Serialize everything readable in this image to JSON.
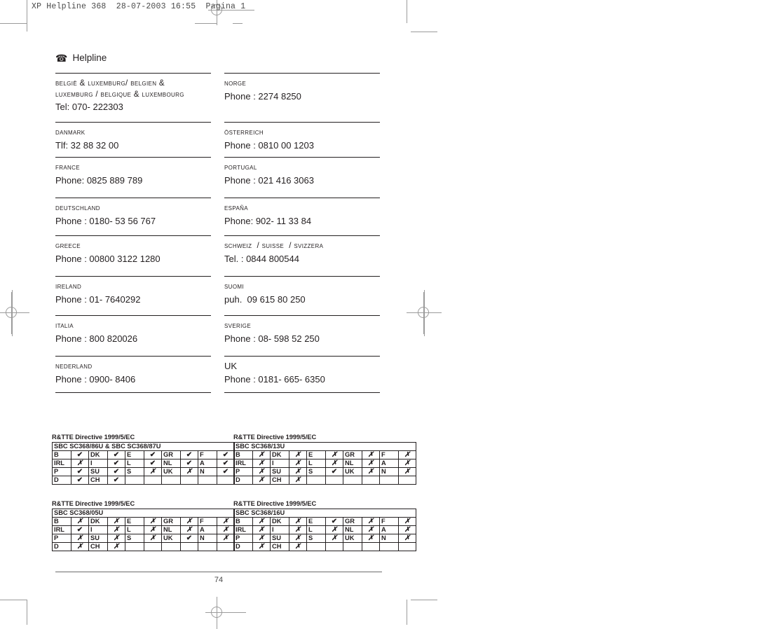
{
  "document": {
    "header_line": "XP Helpline 368  28-07-2003 16:55  Pagina 1",
    "title": "Helpline",
    "phone_icon": "☎",
    "page_number": "74"
  },
  "contacts": {
    "left_column": [
      {
        "country": "België & Luxemburg/ Belgien &\nLuxemburg / Belgique & Luxembourg",
        "phone": "Tel: 070- 222303"
      },
      {
        "country": "Danmark",
        "phone": "Tlf: 32 88 32 00"
      },
      {
        "country": "France",
        "phone": "Phone: 0825 889 789"
      },
      {
        "country": "Deutschland",
        "phone": "Phone : 0180- 53 56 767"
      },
      {
        "country": "Greece",
        "phone": "Phone : 00800 3122 1280"
      },
      {
        "country": "Ireland",
        "phone": "Phone : 01- 7640292"
      },
      {
        "country": "Italia",
        "phone": "Phone : 800 820026"
      },
      {
        "country": "Nederland",
        "phone": "Phone : 0900- 8406"
      }
    ],
    "right_column": [
      {
        "country": "Norge",
        "phone": "Phone : 2274 8250"
      },
      {
        "country": "Österreich",
        "phone": "Phone : 0810 00 1203"
      },
      {
        "country": "Portugal",
        "phone": "Phone : 021 416 3063"
      },
      {
        "country": "España",
        "phone": "Phone: 902- 11 33 84"
      },
      {
        "country": "Schweiz  / Suisse  / Svizzera",
        "phone": "Tel. : 0844 800544"
      },
      {
        "country": "Suomi",
        "phone": "puh.  09 615 80 250"
      },
      {
        "country": "Sverige",
        "phone": "Phone : 08- 598 52 250"
      },
      {
        "country": "UK",
        "phone": "Phone : 0181- 665- 6350"
      }
    ]
  },
  "rtte_tables": [
    {
      "directive": "R&TTE Directive 1999/5/EC",
      "model": "SBC SC368/86U & SBC SC368/87U",
      "rows": [
        [
          {
            "label": "B",
            "mark": "✔"
          },
          {
            "label": "DK",
            "mark": "✔"
          },
          {
            "label": "E",
            "mark": "✔"
          },
          {
            "label": "GR",
            "mark": "✔"
          },
          {
            "label": "F",
            "mark": "✔"
          }
        ],
        [
          {
            "label": "IRL",
            "mark": "✗"
          },
          {
            "label": "I",
            "mark": "✔"
          },
          {
            "label": "L",
            "mark": "✔"
          },
          {
            "label": "NL",
            "mark": "✔"
          },
          {
            "label": "A",
            "mark": "✔"
          }
        ],
        [
          {
            "label": "P",
            "mark": "✔"
          },
          {
            "label": "SU",
            "mark": "✔"
          },
          {
            "label": "S",
            "mark": "✗"
          },
          {
            "label": "UK",
            "mark": "✗"
          },
          {
            "label": "N",
            "mark": "✔"
          }
        ],
        [
          {
            "label": "D",
            "mark": "✔"
          },
          {
            "label": "CH",
            "mark": "✔"
          },
          {
            "label": "",
            "mark": ""
          },
          {
            "label": "",
            "mark": ""
          },
          {
            "label": "",
            "mark": ""
          }
        ]
      ]
    },
    {
      "directive": "R&TTE Directive 1999/5/EC",
      "model": "SBC SC368/13U",
      "rows": [
        [
          {
            "label": "B",
            "mark": "✗"
          },
          {
            "label": "DK",
            "mark": "✗"
          },
          {
            "label": "E",
            "mark": "✗"
          },
          {
            "label": "GR",
            "mark": "✗"
          },
          {
            "label": "F",
            "mark": "✗"
          }
        ],
        [
          {
            "label": "IRL",
            "mark": "✗"
          },
          {
            "label": "I",
            "mark": "✗"
          },
          {
            "label": "L",
            "mark": "✗"
          },
          {
            "label": "NL",
            "mark": "✗"
          },
          {
            "label": "A",
            "mark": "✗"
          }
        ],
        [
          {
            "label": "P",
            "mark": "✗"
          },
          {
            "label": "SU",
            "mark": "✗"
          },
          {
            "label": "S",
            "mark": "✔"
          },
          {
            "label": "UK",
            "mark": "✗"
          },
          {
            "label": "N",
            "mark": "✗"
          }
        ],
        [
          {
            "label": "D",
            "mark": "✗"
          },
          {
            "label": "CH",
            "mark": "✗"
          },
          {
            "label": "",
            "mark": ""
          },
          {
            "label": "",
            "mark": ""
          },
          {
            "label": "",
            "mark": ""
          }
        ]
      ]
    },
    {
      "directive": "R&TTE Directive 1999/5/EC",
      "model": "SBC SC368/05U",
      "rows": [
        [
          {
            "label": "B",
            "mark": "✗"
          },
          {
            "label": "DK",
            "mark": "✗"
          },
          {
            "label": "E",
            "mark": "✗"
          },
          {
            "label": "GR",
            "mark": "✗"
          },
          {
            "label": "F",
            "mark": "✗"
          }
        ],
        [
          {
            "label": "IRL",
            "mark": "✔"
          },
          {
            "label": "I",
            "mark": "✗"
          },
          {
            "label": "L",
            "mark": "✗"
          },
          {
            "label": "NL",
            "mark": "✗"
          },
          {
            "label": "A",
            "mark": "✗"
          }
        ],
        [
          {
            "label": "P",
            "mark": "✗"
          },
          {
            "label": "SU",
            "mark": "✗"
          },
          {
            "label": "S",
            "mark": "✗"
          },
          {
            "label": "UK",
            "mark": "✔"
          },
          {
            "label": "N",
            "mark": "✗"
          }
        ],
        [
          {
            "label": "D",
            "mark": "✗"
          },
          {
            "label": "CH",
            "mark": "✗"
          },
          {
            "label": "",
            "mark": ""
          },
          {
            "label": "",
            "mark": ""
          },
          {
            "label": "",
            "mark": ""
          }
        ]
      ]
    },
    {
      "directive": "R&TTE Directive 1999/5/EC",
      "model": "SBC SC368/16U",
      "rows": [
        [
          {
            "label": "B",
            "mark": "✗"
          },
          {
            "label": "DK",
            "mark": "✗"
          },
          {
            "label": "E",
            "mark": "✔"
          },
          {
            "label": "GR",
            "mark": "✗"
          },
          {
            "label": "F",
            "mark": "✗"
          }
        ],
        [
          {
            "label": "IRL",
            "mark": "✗"
          },
          {
            "label": "I",
            "mark": "✗"
          },
          {
            "label": "L",
            "mark": "✗"
          },
          {
            "label": "NL",
            "mark": "✗"
          },
          {
            "label": "A",
            "mark": "✗"
          }
        ],
        [
          {
            "label": "P",
            "mark": "✗"
          },
          {
            "label": "SU",
            "mark": "✗"
          },
          {
            "label": "S",
            "mark": "✗"
          },
          {
            "label": "UK",
            "mark": "✗"
          },
          {
            "label": "N",
            "mark": "✗"
          }
        ],
        [
          {
            "label": "D",
            "mark": "✗"
          },
          {
            "label": "CH",
            "mark": "✗"
          },
          {
            "label": "",
            "mark": ""
          },
          {
            "label": "",
            "mark": ""
          },
          {
            "label": "",
            "mark": ""
          }
        ]
      ]
    }
  ]
}
